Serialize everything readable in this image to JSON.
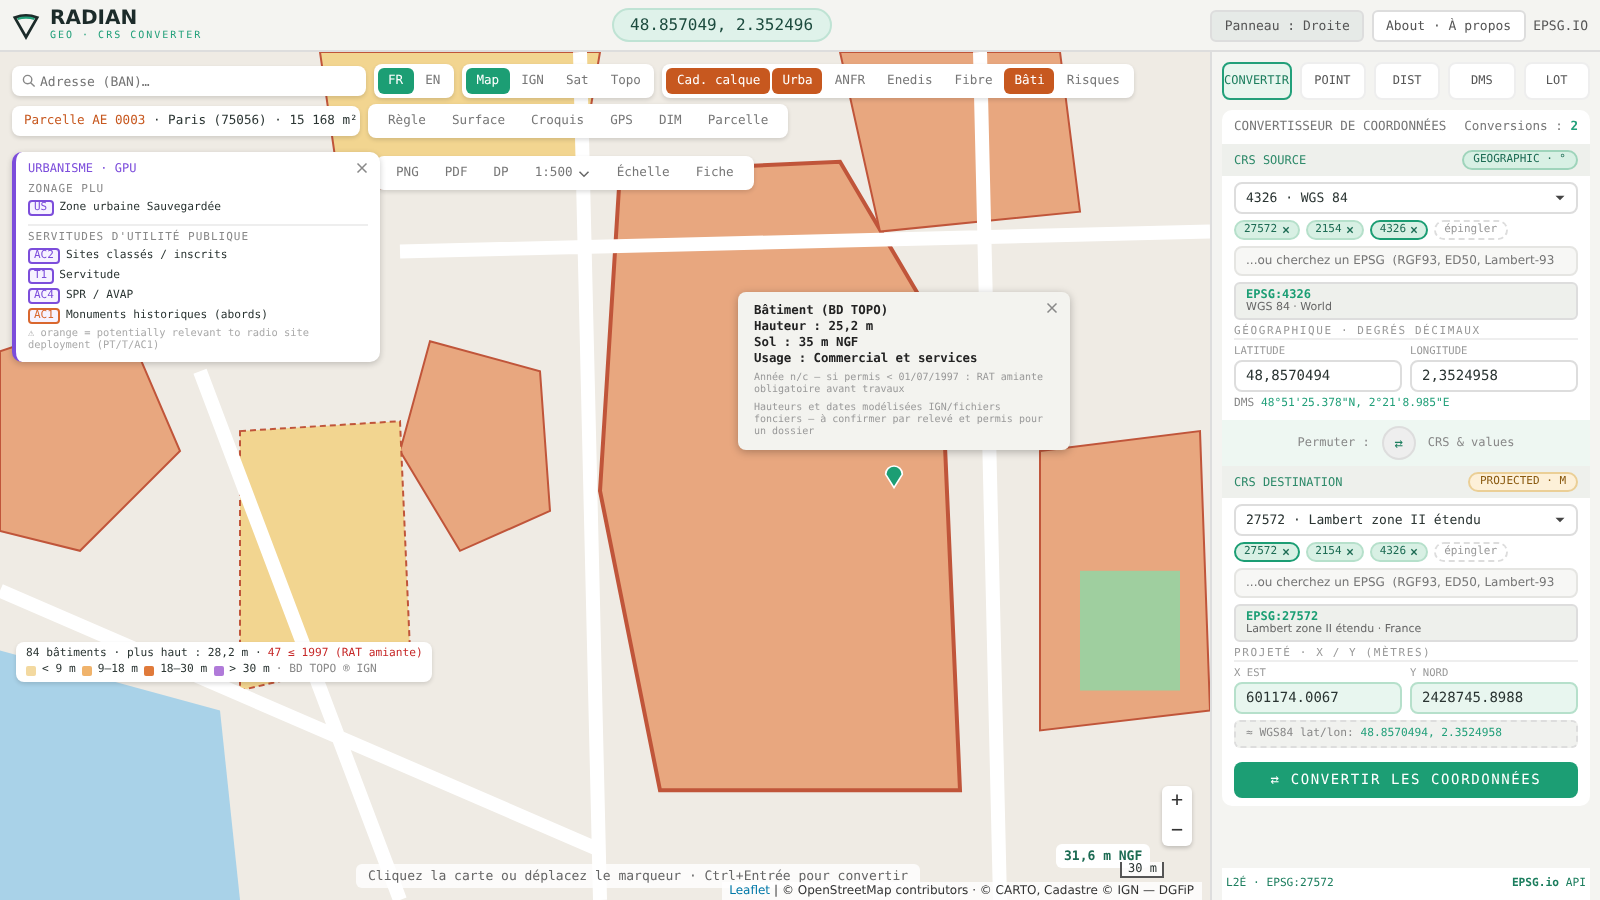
{
  "header": {
    "title": "RADIAN",
    "subtitle": "GEO · CRS CONVERTER",
    "coords": "48.857049, 2.352496",
    "buttons": [
      {
        "label": "Panneau : Droite",
        "kind": "filled"
      },
      {
        "label": "About · À propos",
        "kind": "outline"
      }
    ],
    "link": "EPSG.IO"
  },
  "map": {
    "search": {
      "placeholder": "Adresse (BAN)…"
    },
    "parcel": {
      "name": "Parcelle AE 0003",
      "detail": "· Paris (75056) · 15 168 m²"
    },
    "languages": [
      {
        "label": "FR",
        "selected": true
      },
      {
        "label": "EN",
        "selected": false
      }
    ],
    "basemaps": [
      {
        "label": "Map",
        "selected": true
      },
      {
        "label": "IGN",
        "selected": false
      },
      {
        "label": "Sat",
        "selected": false
      },
      {
        "label": "Topo",
        "selected": false
      }
    ],
    "layers": [
      {
        "label": "Cad. calque",
        "on": true
      },
      {
        "label": "Urba",
        "on": true
      },
      {
        "label": "ANFR",
        "on": false
      },
      {
        "label": "Enedis",
        "on": false
      },
      {
        "label": "Fibre",
        "on": false
      },
      {
        "label": "Bâti",
        "on": true
      },
      {
        "label": "Risques",
        "on": false
      }
    ],
    "tools": [
      "Règle",
      "Surface",
      "Croquis",
      "GPS",
      "DIM",
      "Parcelle"
    ],
    "exports": [
      {
        "label": "PNG",
        "kind": "button"
      },
      {
        "label": "PDF",
        "kind": "button"
      },
      {
        "label": "DP",
        "kind": "button"
      },
      {
        "label": "1:500",
        "kind": "select"
      },
      {
        "label": "Échelle",
        "kind": "button"
      },
      {
        "label": "Fiche",
        "kind": "button"
      }
    ],
    "urbanisme": {
      "title": "URBANISME · GPU",
      "zoning_heading": "ZONAGE PLU",
      "zoning": [
        {
          "code": "US",
          "label": "Zone urbaine Sauvegardée",
          "color": "#7c4ddb"
        }
      ],
      "servitudes_heading": "SERVITUDES D'UTILITÉ PUBLIQUE",
      "servitudes": [
        {
          "code": "AC2",
          "label": "Sites classés / inscrits",
          "color": "#7c4ddb"
        },
        {
          "code": "T1",
          "label": "Servitude",
          "color": "#7c4ddb"
        },
        {
          "code": "AC4",
          "label": "SPR / AVAP",
          "color": "#7c4ddb"
        },
        {
          "code": "AC1",
          "label": "Monuments historiques (abords)",
          "color": "#d9672e"
        }
      ],
      "note": "⚠ orange = potentially relevant to radio site deployment (PT/T/AC1)"
    },
    "building": {
      "title": "Bâtiment (BD TOPO)",
      "lines": [
        "Hauteur : 25,2 m",
        "Sol : 35 m NGF",
        "Usage : Commercial et services"
      ],
      "notes": [
        "Année n/c — si permis < 01/07/1997 : RAT amiante obligatoire avant travaux",
        "Hauteurs et dates modélisées IGN/fichiers fonciers — à confirmer par relevé et permis pour un dossier"
      ]
    },
    "legend": {
      "summary": "84 bâtiments · plus haut : 28,2 m ·",
      "warning": "47 ≤ 1997 (RAT amiante)",
      "items": [
        {
          "label": "< 9 m",
          "color": "#f3d9a0"
        },
        {
          "label": "9–18 m",
          "color": "#f0b36b"
        },
        {
          "label": "18–30 m",
          "color": "#e07a3a"
        },
        {
          "label": "> 30 m",
          "color": "#b07ad9"
        }
      ],
      "source": "· BD TOPO ® IGN"
    },
    "hint": "Cliquez la carte ou déplacez le marqueur · Ctrl+Entrée pour convertir",
    "elevation": "31,6 m NGF",
    "scale": "30 m",
    "zoom": [
      "+",
      "−"
    ],
    "attribution": {
      "link": "Leaflet",
      "text": "| © OpenStreetMap contributors · © CARTO, Cadastre © IGN — DGFiP"
    }
  },
  "panel": {
    "tabs": [
      {
        "label": "CONVERTIR",
        "selected": true
      },
      {
        "label": "POINT",
        "selected": false
      },
      {
        "label": "DIST",
        "selected": false
      },
      {
        "label": "DMS",
        "selected": false
      },
      {
        "label": "LOT",
        "selected": false
      }
    ],
    "title": "CONVERTISSEUR DE COORDONNÉES",
    "counter_label": "Conversions :",
    "counter": "2",
    "source": {
      "heading": "CRS SOURCE",
      "badge": "GEOGRAPHIC · °",
      "select": "4326 · WGS 84",
      "chips": [
        {
          "label": "27572",
          "selected": false
        },
        {
          "label": "2154",
          "selected": false
        },
        {
          "label": "4326",
          "selected": true
        }
      ],
      "pin": "épingler",
      "search_placeholder": "...ou cherchez un EPSG  (RGF93, ED50, Lambert-93",
      "result_code": "EPSG:4326",
      "result_name": "WGS 84 · World",
      "section": "GÉOGRAPHIQUE · DEGRÉS DÉCIMAUX",
      "fields": [
        {
          "label": "LATITUDE",
          "value": "48,8570494"
        },
        {
          "label": "LONGITUDE",
          "value": "2,3524958"
        }
      ],
      "extra_label": "DMS",
      "extra_value": "48°51'25.378\"N, 2°21'8.985\"E"
    },
    "swap": {
      "label": "Permuter :",
      "button": "⇄",
      "after": "CRS & values"
    },
    "destination": {
      "heading": "CRS DESTINATION",
      "badge": "PROJECTED · M",
      "select": "27572 · Lambert zone II étendu",
      "chips": [
        {
          "label": "27572",
          "selected": true
        },
        {
          "label": "2154",
          "selected": false
        },
        {
          "label": "4326",
          "selected": false
        }
      ],
      "pin": "épingler",
      "search_placeholder": "...ou cherchez un EPSG  (RGF93, ED50, Lambert-93",
      "result_code": "EPSG:27572",
      "result_name": "Lambert zone II étendu · France",
      "section": "PROJETÉ · X / Y (MÈTRES)",
      "fields": [
        {
          "label": "X EST",
          "value": "601174.0067"
        },
        {
          "label": "Y NORD",
          "value": "2428745.8988"
        }
      ],
      "extra_label": "≈ WGS84 lat/lon:",
      "extra_value": "48.8570494, 2.3524958"
    },
    "convert": "⇄ CONVERTIR LES COORDONNÉES",
    "footer": {
      "left": "L2É · EPSG:27572",
      "right": "EPSG.io",
      "right_suffix": "API"
    }
  }
}
